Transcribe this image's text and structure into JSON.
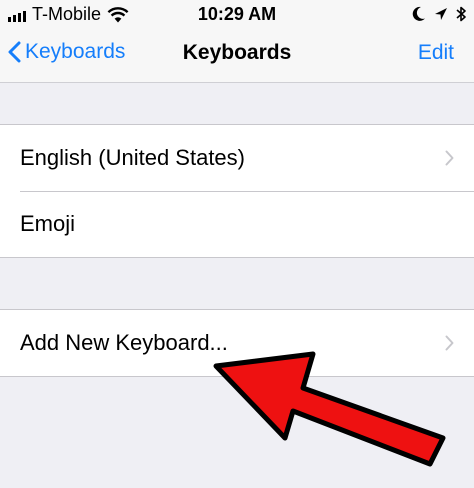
{
  "status_bar": {
    "carrier": "T-Mobile",
    "time": "10:29 AM",
    "icons": [
      "signal-bars-icon",
      "wifi-icon",
      "moon-icon",
      "location-arrow-icon",
      "bluetooth-icon"
    ]
  },
  "nav": {
    "back_label": "Keyboards",
    "title": "Keyboards",
    "edit_label": "Edit",
    "accent_color": "#157efb"
  },
  "keyboards_list": {
    "items": [
      {
        "label": "English (United States)",
        "chevron": true
      },
      {
        "label": "Emoji",
        "chevron": false
      }
    ]
  },
  "add_keyboard": {
    "label": "Add New Keyboard..."
  },
  "annotation": {
    "icon": "red-pointer-arrow-icon",
    "color": "#ee1111"
  }
}
